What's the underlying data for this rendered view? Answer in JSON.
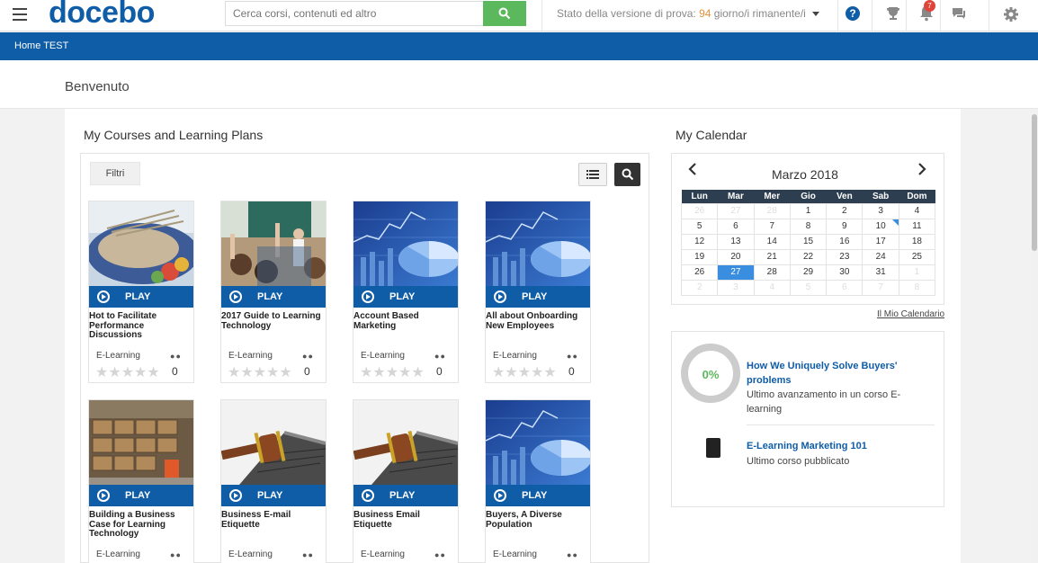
{
  "header": {
    "logo": "docebo",
    "logo_mark": "®",
    "search_placeholder": "Cerca corsi, contenuti ed altro",
    "trial_prefix": "Stato della versione di prova: ",
    "trial_days": "94",
    "trial_suffix": " giorno/i rimanente/i",
    "notification_count": "7",
    "icons": [
      "menu-icon",
      "search-icon",
      "help-icon",
      "trophy-icon",
      "bell-icon",
      "chat-icon",
      "gear-icon"
    ],
    "colors": {
      "brand": "#0f5ca7",
      "search_button": "#5cb85c",
      "badge": "#e0453a"
    }
  },
  "nav": {
    "home_label": "Home TEST"
  },
  "welcome": {
    "title": "Benvenuto"
  },
  "courses": {
    "section_title": "My Courses and Learning Plans",
    "filter_label": "Filtri",
    "play_label": "PLAY",
    "items": [
      {
        "title": "Hot to Facilitate Performance Discussions",
        "type": "E-Learning",
        "rating_count": "0",
        "thumb": "food"
      },
      {
        "title": "2017 Guide to Learning Technology",
        "type": "E-Learning",
        "rating_count": "0",
        "thumb": "classroom"
      },
      {
        "title": "Account Based Marketing",
        "type": "E-Learning",
        "rating_count": "0",
        "thumb": "chart"
      },
      {
        "title": "All about Onboarding New Employees",
        "type": "E-Learning",
        "rating_count": "0",
        "thumb": "chart"
      },
      {
        "title": "Building a Business Case for Learning Technology",
        "type": "E-Learning",
        "thumb": "warehouse"
      },
      {
        "title": "Business E-mail Etiquette",
        "type": "E-Learning",
        "thumb": "gavel"
      },
      {
        "title": "Business Email Etiquette",
        "type": "E-Learning",
        "thumb": "gavel"
      },
      {
        "title": "Buyers, A Diverse Population",
        "type": "E-Learning",
        "thumb": "chart"
      }
    ]
  },
  "calendar": {
    "section_title": "My Calendar",
    "month_label": "Marzo 2018",
    "weekdays": [
      "Lun",
      "Mar",
      "Mer",
      "Gio",
      "Ven",
      "Sab",
      "Dom"
    ],
    "weeks": [
      [
        "26",
        "27",
        "28",
        "1",
        "2",
        "3",
        "4"
      ],
      [
        "5",
        "6",
        "7",
        "8",
        "9",
        "10",
        "11"
      ],
      [
        "12",
        "13",
        "14",
        "15",
        "16",
        "17",
        "18"
      ],
      [
        "19",
        "20",
        "21",
        "22",
        "23",
        "24",
        "25"
      ],
      [
        "26",
        "27",
        "28",
        "29",
        "30",
        "31",
        "1"
      ],
      [
        "2",
        "3",
        "4",
        "5",
        "6",
        "7",
        "8"
      ]
    ],
    "today": "27",
    "link_label": "Il Mio Calendario"
  },
  "activity": {
    "progress_label": "0%",
    "course_link": "How We Uniquely Solve Buyers' problems",
    "course_sub": "Ultimo avanzamento in un corso E-learning",
    "published_link": "E-Learning Marketing 101",
    "published_sub": "Ultimo corso pubblicato"
  }
}
